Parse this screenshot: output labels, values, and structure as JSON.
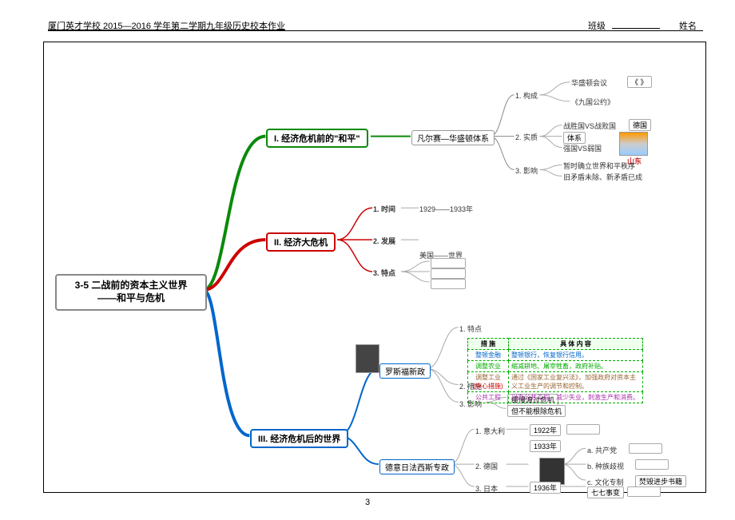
{
  "header": {
    "title": "厦门英才学校 2015—2016 学年第二学期九年级历史校本作业",
    "class_label": "班级",
    "name_label": "姓名"
  },
  "root": {
    "line1": "3-5  二战前的资本主义世界",
    "line2": "——和平与危机"
  },
  "b1": {
    "label": "I. 经济危机前的\"和平\"",
    "sub": "凡尔赛—华盛顿体系",
    "n1": "1. 构成",
    "n1a": "华盛顿会议",
    "n1b": "《九国公约》",
    "n1c": "《        》",
    "n2": "2. 实质",
    "n2a": "体系",
    "n2b": "战胜国VS战败国",
    "n2c": "强国VS弱国",
    "n2d": "德国",
    "n2e": "山东",
    "n3": "3. 影响",
    "n3a": "暂时确立世界和平秩序",
    "n3b": "旧矛盾未除、新矛盾已成"
  },
  "b2": {
    "label": "II. 经济大危机",
    "n1": "1. 时间",
    "n1a": "1929——1933年",
    "n2": "2. 发展",
    "n2a": "美国——世界",
    "n3": "3. 特点"
  },
  "b3": {
    "label": "III. 经济危机后的世界",
    "sub1": "罗斯福新政",
    "sub2": "德意日法西斯专政",
    "r1": "1. 特点",
    "r2": "2. 措施",
    "r3": "3. 影响",
    "r3a": "缓慢渡过危机",
    "r3b": "但不能根除危机",
    "f1": "1. 意大利",
    "f1a": "1922年",
    "f2": "2. 德国",
    "f2a": "1933年",
    "f2b": "a. 共产党",
    "f2c": "b. 种族歧视",
    "f2d": "c. 文化专制",
    "f2e": "焚毁进步书籍",
    "f3": "3. 日本",
    "f3a": "1936年",
    "f3b": "七七事变"
  },
  "table": {
    "h1": "措 施",
    "h2": "具 体 内 容",
    "r1a": "整顿金融",
    "r1b": "整顿银行，恢复银行信用。",
    "r2a": "调整农业",
    "r2b": "缩减耕地、屠宰牲畜，政府补贴。",
    "r3a": "调整工业",
    "r3a2": "(中心措施)",
    "r3b": "通过《国家工业复兴法》，加强政府对资本主义工业生产的调节和控制。",
    "r4a": "公共工程",
    "r4b": "兴办公共工程，减少失业，刺激生产和消费。"
  },
  "page_number": "3"
}
